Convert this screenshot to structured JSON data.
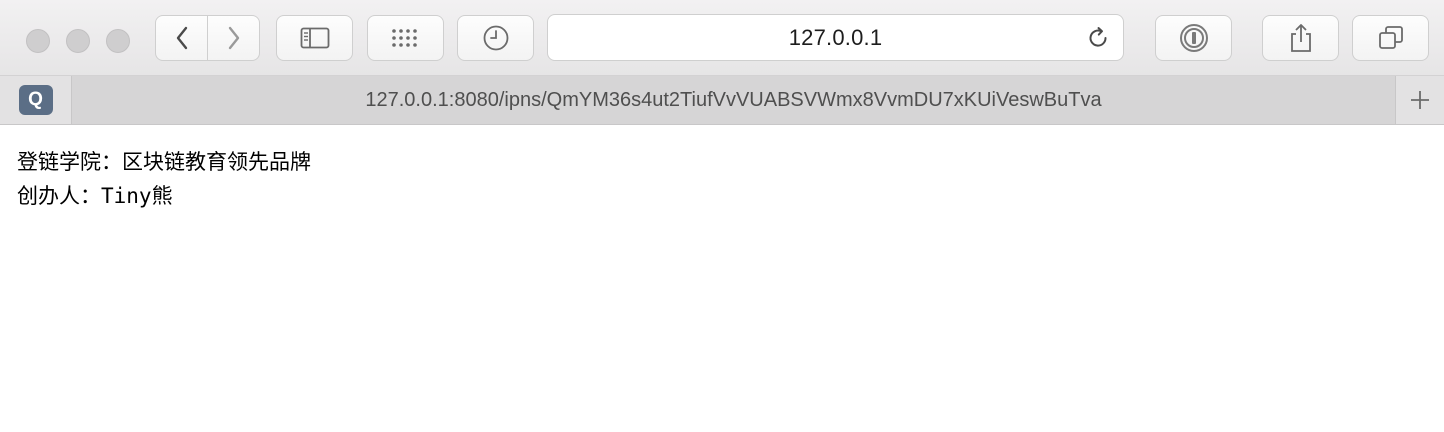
{
  "window": {
    "controls": [
      "close",
      "minimize",
      "zoom"
    ]
  },
  "toolbar": {
    "icons": {
      "back": "chevron-left-icon",
      "forward": "chevron-right-icon",
      "sidebar": "sidebar-icon",
      "top_sites": "grid-icon",
      "history": "clock-icon",
      "reload": "reload-icon",
      "password": "1password-icon",
      "share": "share-icon",
      "tabs": "tab-overview-icon"
    },
    "address": "127.0.0.1"
  },
  "tabbar": {
    "favicon_letter": "Q",
    "tab_title": "127.0.0.1:8080/ipns/QmYM36s4ut2TiufVvVUABSVWmx8VvmDU7xKUiVeswBuTva",
    "new_tab_label": "+"
  },
  "content": {
    "line1": "登链学院：区块链教育领先品牌",
    "line2": "创办人：Tiny熊"
  }
}
